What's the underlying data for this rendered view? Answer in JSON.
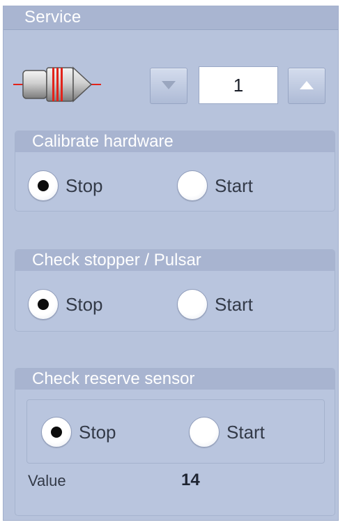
{
  "panel": {
    "title": "Service"
  },
  "stepper": {
    "value": "1"
  },
  "groups": [
    {
      "title": "Calibrate hardware",
      "options": [
        {
          "label": "Stop",
          "selected": true
        },
        {
          "label": "Start",
          "selected": false
        }
      ]
    },
    {
      "title": "Check stopper / Pulsar",
      "options": [
        {
          "label": "Stop",
          "selected": true
        },
        {
          "label": "Start",
          "selected": false
        }
      ]
    },
    {
      "title": "Check reserve sensor",
      "options": [
        {
          "label": "Stop",
          "selected": true
        },
        {
          "label": "Start",
          "selected": false
        }
      ],
      "value_label": "Value",
      "value": "14"
    }
  ],
  "icons": {
    "device": "plunger-device-icon",
    "down": "triangle-down-icon",
    "up": "triangle-up-icon"
  },
  "colors": {
    "panel_bg": "#b7c3dc",
    "header_bg": "#a9b5d1",
    "accent_red": "#e2231a"
  }
}
